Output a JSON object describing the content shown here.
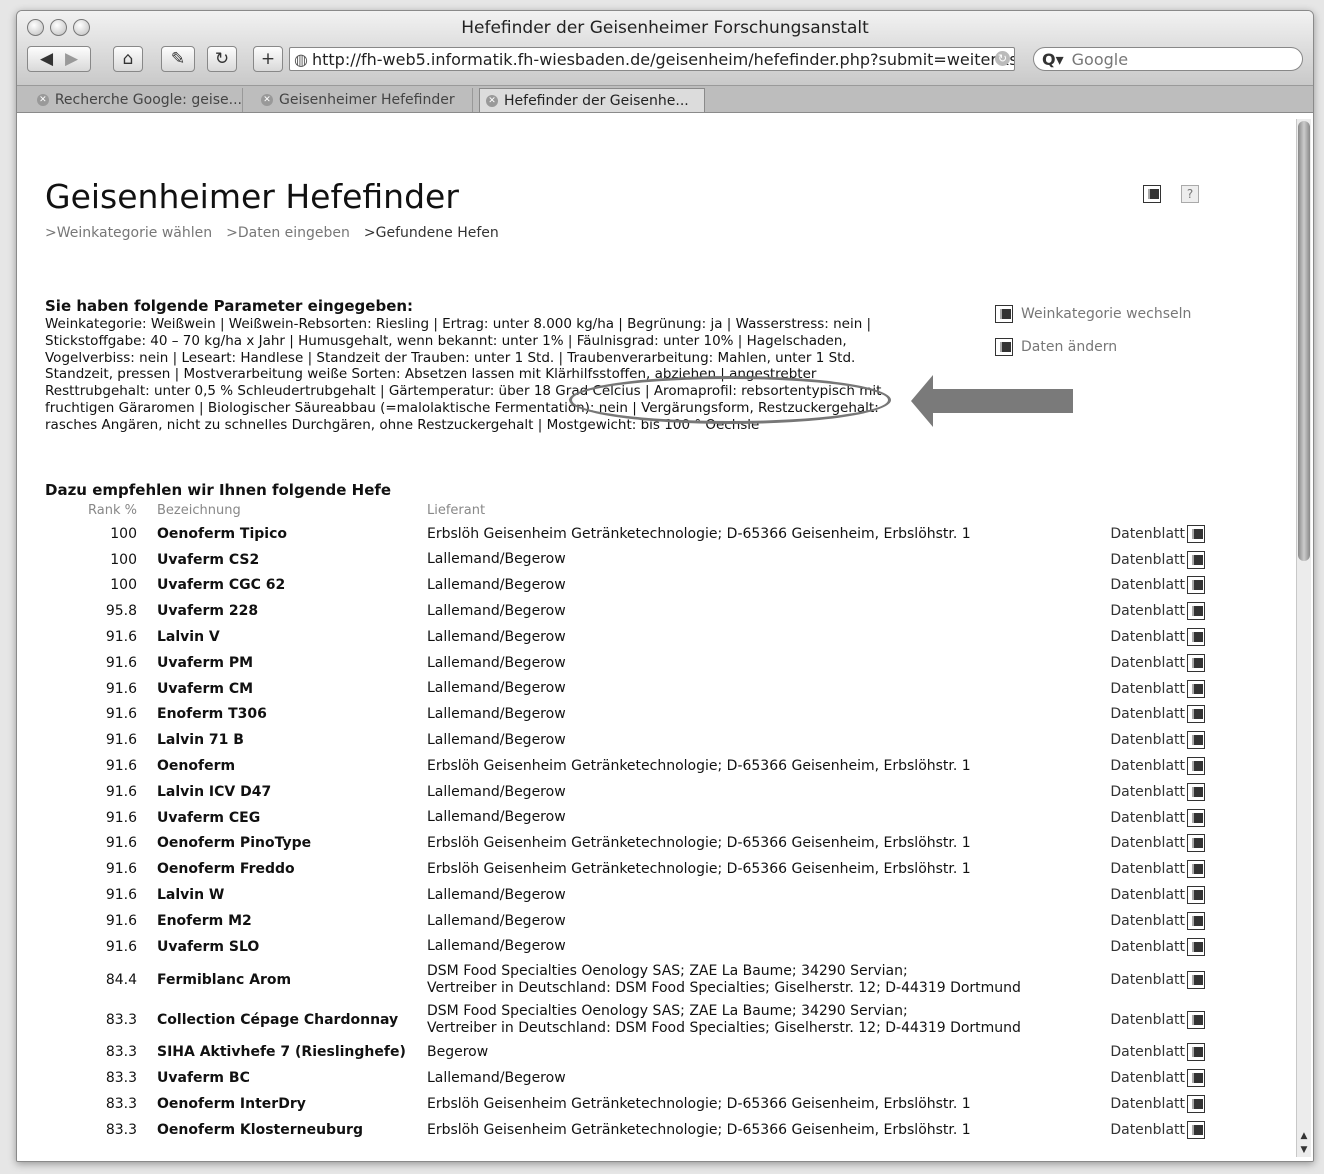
{
  "window": {
    "title": "Hefefinder der Geisenheimer Forschungsanstalt"
  },
  "toolbar": {
    "url": "http://fh-web5.informatik.fh-wiesbaden.de/geisenheim/hefefinder.php?submit=weiter&s",
    "search_placeholder": "Google"
  },
  "tabs": [
    {
      "label": "Recherche Google: geise..."
    },
    {
      "label": "Geisenheimer Hefefinder"
    },
    {
      "label": "Hefefinder der Geisenhe..."
    }
  ],
  "page": {
    "title": "Geisenheimer Hefefinder",
    "breadcrumbs": [
      ">Weinkategorie wählen",
      ">Daten eingeben",
      ">Gefundene Hefen"
    ]
  },
  "side_links": [
    {
      "label": "Weinkategorie wechseln"
    },
    {
      "label": "Daten ändern"
    }
  ],
  "params": {
    "heading": "Sie haben folgende Parameter eingegeben:",
    "text": "Weinkategorie: Weißwein | Weißwein-Rebsorten: Riesling | Ertrag: unter 8.000 kg/ha | Begrünung: ja | Wasserstress: nein | Stickstoffgabe: 40 – 70 kg/ha x Jahr | Humusgehalt, wenn bekannt: unter 1% | Fäulnisgrad: unter 10% | Hagelschaden, Vogelverbiss: nein | Leseart: Handlese | Standzeit der Trauben: unter 1 Std. | Traubenverarbeitung: Mahlen, unter 1 Std. Standzeit, pressen | Mostverarbeitung weiße Sorten: Absetzen lassen mit Klärhilfsstoffen, abziehen | angestrebter Resttrubgehalt: unter 0,5 % Schleudertrubgehalt | Gärtemperatur: über 18 Grad Celcius | Aromaprofil: rebsortentypisch mit fruchtigen Gäraromen | Biologischer Säureabbau (=malolaktische Fermentation): nein | Vergärungsform, Restzuckergehalt: rasches Angären, nicht zu schnelles Durchgären, ohne Restzuckergehalt | Mostgewicht: bis 100 ° Oechsle"
  },
  "results": {
    "heading": "Dazu empfehlen wir Ihnen folgende Hefe",
    "columns": {
      "rank": "Rank %",
      "name": "Bezeichnung",
      "supplier": "Lieferant"
    },
    "datasheet_label": "Datenblatt",
    "rows": [
      {
        "rank": "100",
        "name": "Oenoferm Tipico",
        "supplier": "Erbslöh Geisenheim Getränketechnologie; D-65366 Geisenheim, Erbslöhstr. 1"
      },
      {
        "rank": "100",
        "name": "Uvaferm CS2",
        "supplier": "Lallemand/Begerow"
      },
      {
        "rank": "100",
        "name": "Uvaferm CGC 62",
        "supplier": "Lallemand/Begerow"
      },
      {
        "rank": "95.8",
        "name": "Uvaferm 228",
        "supplier": "Lallemand/Begerow"
      },
      {
        "rank": "91.6",
        "name": "Lalvin V",
        "supplier": "Lallemand/Begerow"
      },
      {
        "rank": "91.6",
        "name": "Uvaferm PM",
        "supplier": "Lallemand/Begerow"
      },
      {
        "rank": "91.6",
        "name": "Uvaferm CM",
        "supplier": "Lallemand/Begerow"
      },
      {
        "rank": "91.6",
        "name": "Enoferm T306",
        "supplier": "Lallemand/Begerow"
      },
      {
        "rank": "91.6",
        "name": "Lalvin 71 B",
        "supplier": "Lallemand/Begerow"
      },
      {
        "rank": "91.6",
        "name": "Oenoferm",
        "supplier": "Erbslöh Geisenheim Getränketechnologie; D-65366 Geisenheim, Erbslöhstr. 1"
      },
      {
        "rank": "91.6",
        "name": "Lalvin ICV D47",
        "supplier": "Lallemand/Begerow"
      },
      {
        "rank": "91.6",
        "name": "Uvaferm CEG",
        "supplier": "Lallemand/Begerow"
      },
      {
        "rank": "91.6",
        "name": "Oenoferm PinoType",
        "supplier": "Erbslöh Geisenheim Getränketechnologie; D-65366 Geisenheim, Erbslöhstr. 1"
      },
      {
        "rank": "91.6",
        "name": "Oenoferm Freddo",
        "supplier": "Erbslöh Geisenheim Getränketechnologie; D-65366 Geisenheim, Erbslöhstr. 1"
      },
      {
        "rank": "91.6",
        "name": "Lalvin W",
        "supplier": "Lallemand/Begerow"
      },
      {
        "rank": "91.6",
        "name": "Enoferm M2",
        "supplier": "Lallemand/Begerow"
      },
      {
        "rank": "91.6",
        "name": "Uvaferm SLO",
        "supplier": "Lallemand/Begerow"
      },
      {
        "rank": "84.4",
        "name": "Fermiblanc Arom",
        "supplier": "DSM Food Specialties Oenology SAS; ZAE La Baume; 34290 Servian;\nVertreiber in Deutschland: DSM Food Specialties; Giselherstr. 12; D-44319 Dortmund"
      },
      {
        "rank": "83.3",
        "name": "Collection Cépage Chardonnay",
        "supplier": "DSM Food Specialties Oenology SAS; ZAE La Baume; 34290 Servian;\nVertreiber in Deutschland: DSM Food Specialties; Giselherstr. 12; D-44319 Dortmund"
      },
      {
        "rank": "83.3",
        "name": "SIHA Aktivhefe 7 (Rieslinghefe)",
        "supplier": "Begerow"
      },
      {
        "rank": "83.3",
        "name": "Uvaferm BC",
        "supplier": "Lallemand/Begerow"
      },
      {
        "rank": "83.3",
        "name": "Oenoferm InterDry",
        "supplier": "Erbslöh Geisenheim Getränketechnologie; D-65366 Geisenheim, Erbslöhstr. 1"
      },
      {
        "rank": "83.3",
        "name": "Oenoferm Klosterneuburg",
        "supplier": "Erbslöh Geisenheim Getränketechnologie; D-65366 Geisenheim, Erbslöhstr. 1"
      }
    ]
  }
}
